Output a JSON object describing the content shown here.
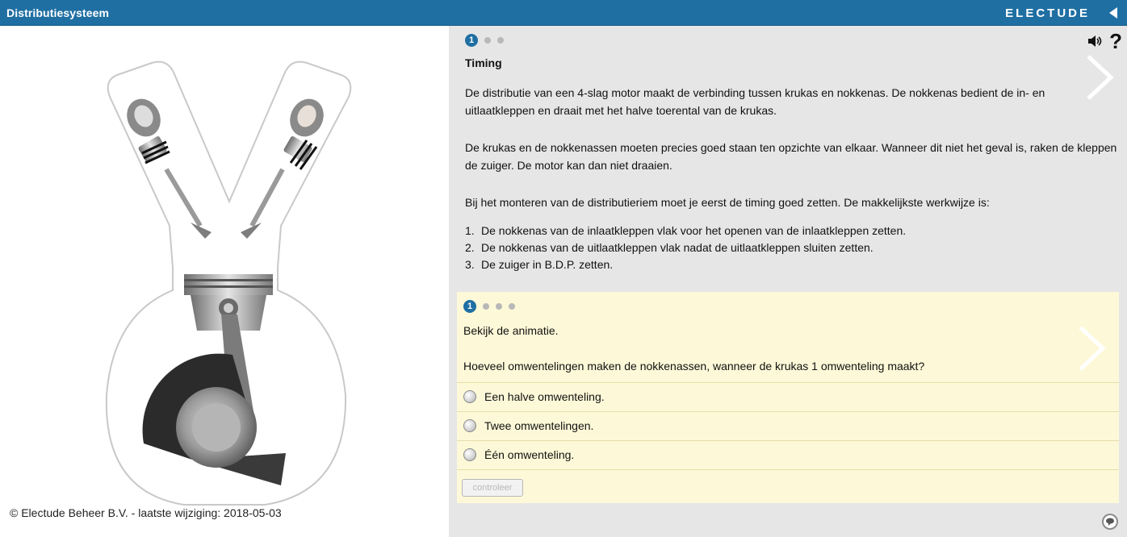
{
  "header": {
    "title": "Distributiesysteem",
    "brand": "ELECTUDE"
  },
  "footer": {
    "copyright": "© Electude Beheer B.V. - laatste wijziging: 2018-05-03"
  },
  "theory": {
    "step_number": "1",
    "title": "Timing",
    "paragraphs": [
      "De distributie van een 4-slag motor maakt de verbinding tussen krukas en nokkenas. De nokkenas bedient de in- en uitlaatkleppen en draait met het halve toerental van de krukas.",
      "De krukas en de nokkenassen moeten precies goed staan ten opzichte van elkaar. Wanneer dit niet het geval is, raken de kleppen de zuiger. De motor kan dan niet draaien.",
      "Bij het monteren van de distributieriem moet je eerst de timing goed zetten. De makkelijkste werkwijze is:"
    ],
    "list": [
      {
        "num": "1.",
        "text": "De nokkenas van de inlaatkleppen vlak voor het openen van de inlaatkleppen zetten."
      },
      {
        "num": "2.",
        "text": "De nokkenas van de uitlaatkleppen vlak nadat de uitlaatkleppen sluiten zetten."
      },
      {
        "num": "3.",
        "text": "De zuiger in B.D.P. zetten."
      }
    ]
  },
  "question": {
    "step_number": "1",
    "instruction": "Bekijk de animatie.",
    "text": "Hoeveel omwentelingen maken de nokkenassen, wanneer de krukas 1 omwenteling maakt?",
    "options": [
      "Een halve omwenteling.",
      "Twee omwentelingen.",
      "Één omwenteling."
    ],
    "check_label": "controleer"
  },
  "colors": {
    "header_bg": "#1f6fa3",
    "question_bg": "#fdf9d8",
    "panel_bg": "#e6e6e6"
  }
}
